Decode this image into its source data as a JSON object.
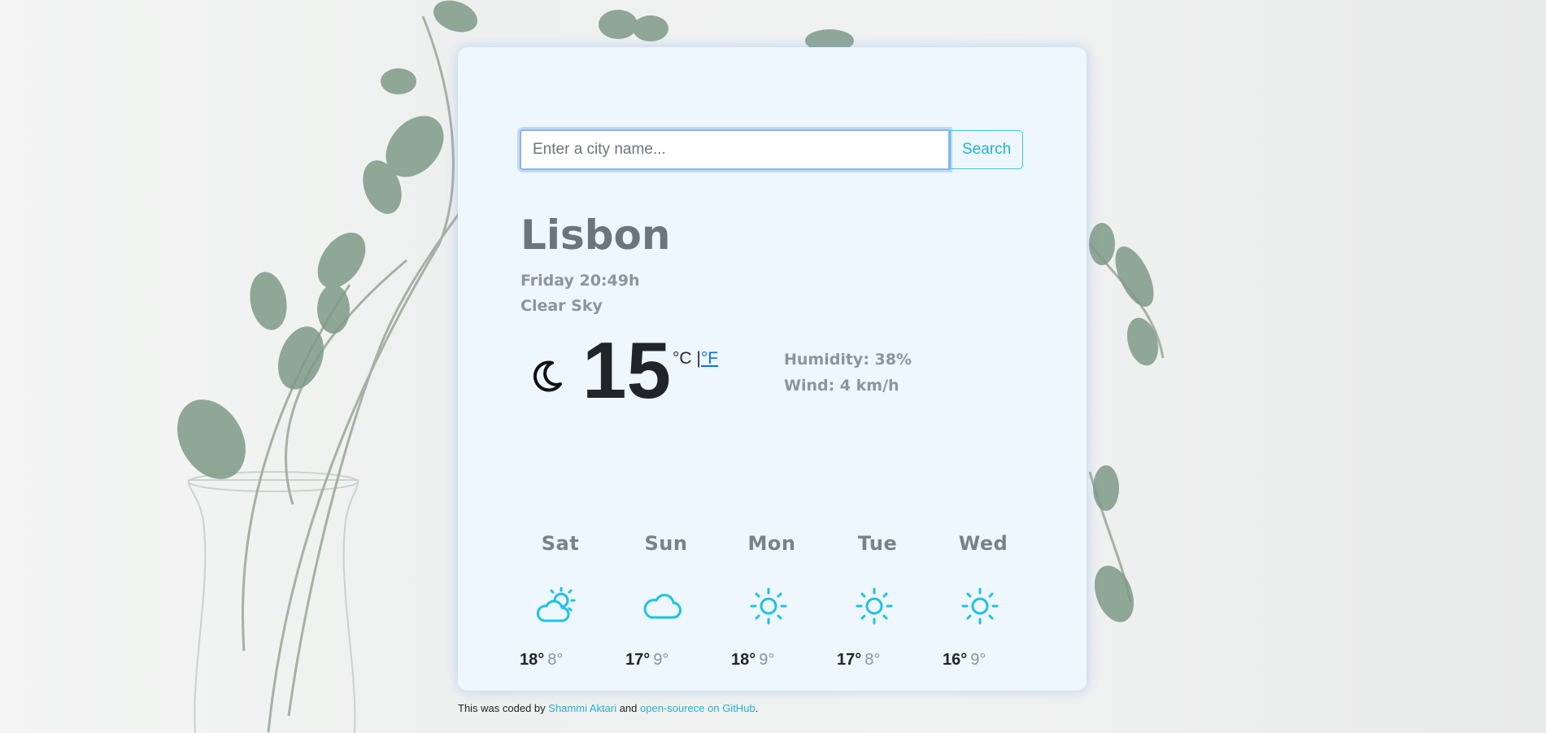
{
  "search": {
    "placeholder": "Enter a city name...",
    "button_label": "Search"
  },
  "current": {
    "city": "Lisbon",
    "datetime": "Friday 20:49h",
    "description": "Clear Sky",
    "icon": "moon-icon",
    "temperature": "15",
    "unit_celsius": "°C",
    "unit_separator": "|",
    "unit_fahrenheit": "°F",
    "humidity": "Humidity: 38%",
    "wind": "Wind: 4 km/h"
  },
  "forecast": [
    {
      "day": "Sat",
      "icon": "partly-cloudy-icon",
      "max": "18°",
      "min": "8°"
    },
    {
      "day": "Sun",
      "icon": "cloud-icon",
      "max": "17°",
      "min": "9°"
    },
    {
      "day": "Mon",
      "icon": "sun-icon",
      "max": "18°",
      "min": "9°"
    },
    {
      "day": "Tue",
      "icon": "sun-icon",
      "max": "17°",
      "min": "8°"
    },
    {
      "day": "Wed",
      "icon": "sun-icon",
      "max": "16°",
      "min": "9°"
    }
  ],
  "footer": {
    "text_before": "This was coded by ",
    "author_link": "Shammi Aktari",
    "text_middle": " and ",
    "repo_link": "open-sourece on GitHub",
    "text_after": "."
  },
  "colors": {
    "accent": "#22b2d2",
    "card_bg": "#eef6fe",
    "link_blue": "#0d6efd"
  }
}
